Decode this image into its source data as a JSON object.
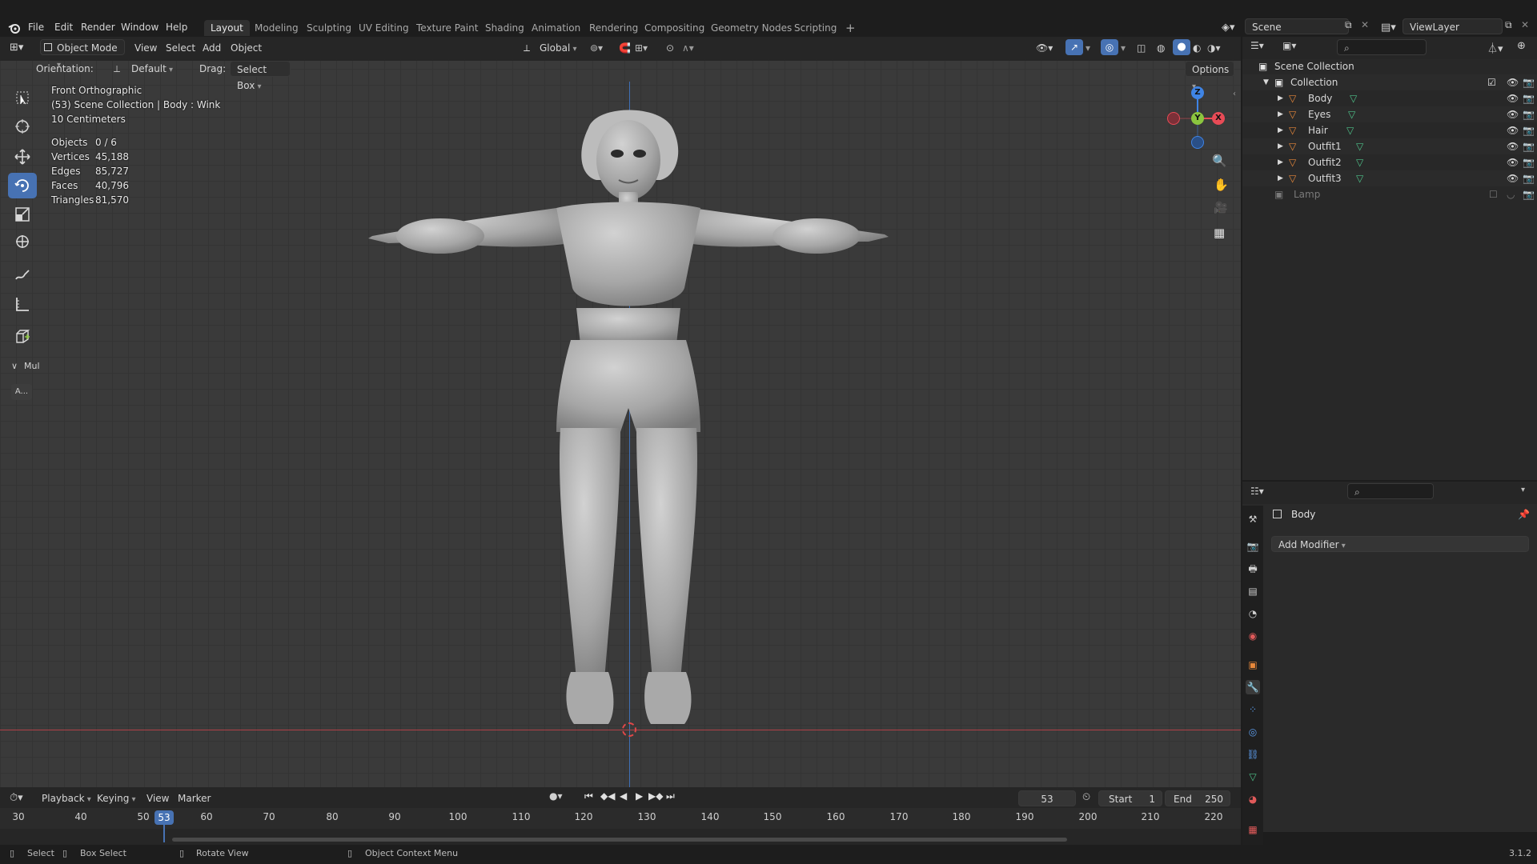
{
  "menubar": {
    "items": [
      "File",
      "Edit",
      "Render",
      "Window",
      "Help"
    ]
  },
  "workspaces": {
    "tabs": [
      "Layout",
      "Modeling",
      "Sculpting",
      "UV Editing",
      "Texture Paint",
      "Shading",
      "Animation",
      "Rendering",
      "Compositing",
      "Geometry Nodes",
      "Scripting"
    ],
    "active": "Layout",
    "add_label": "+"
  },
  "scene": {
    "label": "Scene"
  },
  "view_layer": {
    "label": "ViewLayer"
  },
  "viewport_header": {
    "mode": "Object Mode",
    "menus": [
      "View",
      "Select",
      "Add",
      "Object"
    ],
    "transform_orientation": "Global"
  },
  "tool_header": {
    "orientation_label": "Orientation:",
    "orientation_value": "Default",
    "drag_label": "Drag:",
    "drag_value": "Select Box",
    "options_label": "Options"
  },
  "overlay": {
    "view_name": "Front Orthographic",
    "context": "(53) Scene Collection | Body : Wink",
    "scale": "10 Centimeters",
    "stats": [
      {
        "label": "Objects",
        "value": "0 / 6"
      },
      {
        "label": "Vertices",
        "value": "45,188"
      },
      {
        "label": "Edges",
        "value": "85,727"
      },
      {
        "label": "Faces",
        "value": "40,796"
      },
      {
        "label": "Triangles",
        "value": "81,570"
      }
    ]
  },
  "toolbar": {
    "panel_label": "Mul",
    "extra_label": "A..."
  },
  "gizmo": {
    "z": "Z",
    "y": "Y",
    "x": "X"
  },
  "outliner": {
    "root": "Scene Collection",
    "collection": "Collection",
    "objects": [
      "Body",
      "Eyes",
      "Hair",
      "Outfit1",
      "Outfit2",
      "Outfit3"
    ],
    "extra": "Lamp"
  },
  "properties": {
    "object_name": "Body",
    "add_modifier": "Add Modifier"
  },
  "timeline": {
    "menus": [
      "Playback",
      "Keying",
      "View",
      "Marker"
    ],
    "current_frame": "53",
    "start_label": "Start",
    "start_value": "1",
    "end_label": "End",
    "end_value": "250",
    "ticks": [
      "30",
      "40",
      "50",
      "60",
      "70",
      "80",
      "90",
      "100",
      "110",
      "120",
      "130",
      "140",
      "150",
      "160",
      "170",
      "180",
      "190",
      "200",
      "210",
      "220"
    ]
  },
  "statusbar": {
    "items": [
      "Select",
      "Box Select",
      "Rotate View",
      "Object Context Menu"
    ],
    "version": "3.1.2"
  },
  "colors": {
    "accent": "#4772b3",
    "x_axis": "#e84b56",
    "y_axis": "#8bc53f",
    "z_axis": "#3f84e5",
    "mesh_icon": "#e8883a",
    "mesh_data_icon": "#4ec38a"
  }
}
